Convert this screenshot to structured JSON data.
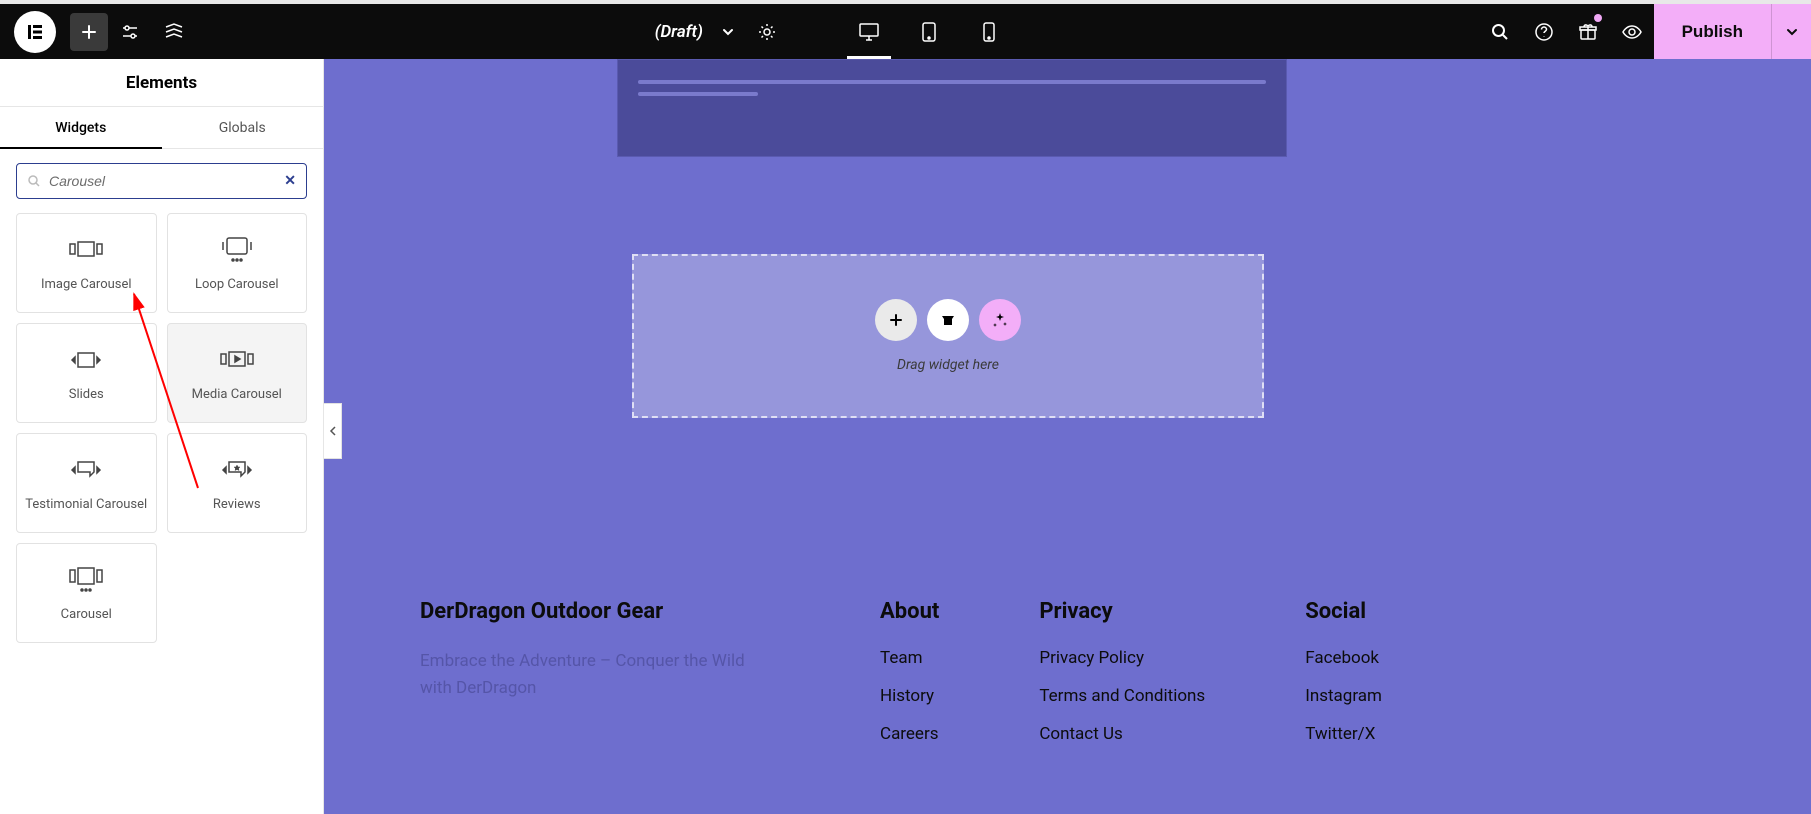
{
  "topbar": {
    "draft_label": "(Draft)",
    "publish_label": "Publish"
  },
  "sidebar": {
    "title": "Elements",
    "tabs": {
      "widgets": "Widgets",
      "globals": "Globals"
    },
    "search_value": "Carousel",
    "widgets": [
      {
        "label": "Image Carousel"
      },
      {
        "label": "Loop Carousel"
      },
      {
        "label": "Slides"
      },
      {
        "label": "Media Carousel"
      },
      {
        "label": "Testimonial Carousel"
      },
      {
        "label": "Reviews"
      },
      {
        "label": "Carousel"
      }
    ]
  },
  "canvas": {
    "drop_text": "Drag widget here"
  },
  "footer": {
    "brand_title": "DerDragon Outdoor Gear",
    "tagline": "Embrace the Adventure – Conquer the Wild with DerDragon",
    "columns": [
      {
        "heading": "About",
        "links": [
          "Team",
          "History",
          "Careers"
        ]
      },
      {
        "heading": "Privacy",
        "links": [
          "Privacy Policy",
          "Terms and Conditions",
          "Contact Us"
        ]
      },
      {
        "heading": "Social",
        "links": [
          "Facebook",
          "Instagram",
          "Twitter/X"
        ]
      }
    ]
  }
}
